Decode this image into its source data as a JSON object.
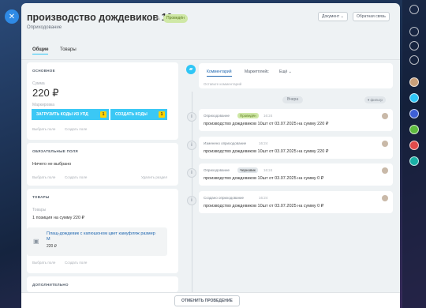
{
  "header": {
    "title": "производство дождевиков 10шт",
    "status_badge": "Проведён",
    "subtitle": "Оприходование",
    "document_button": "Документ",
    "feedback_button": "Обратная связь"
  },
  "tabs": [
    {
      "label": "Общие",
      "active": true
    },
    {
      "label": "Товары",
      "active": false
    }
  ],
  "main_section": {
    "title": "ОСНОВНОЕ",
    "sum_label": "Сумма",
    "sum_value": "220 ₽",
    "marking_label": "Маркировка",
    "upload_button": "ЗАГРУЗИТЬ КОДЫ ИЗ УПД",
    "upload_count": "1",
    "create_codes_button": "СОЗДАТЬ КОДЫ",
    "create_count": "1",
    "select_field": "Выбрать поле",
    "create_field": "Создать поле"
  },
  "required_section": {
    "title": "ОБЯЗАТЕЛЬНЫЕ ПОЛЯ",
    "value": "Ничего не выбрано",
    "select_field": "Выбрать поле",
    "create_field": "Создать поле",
    "hide_section": "Удалить раздел"
  },
  "products_section": {
    "title": "ТОВАРЫ",
    "label": "Товары",
    "summary": "1 позиция на сумму 220 ₽",
    "product_name": "Плащ-дождевик с капюшоном цвет камуфляж размер M",
    "product_price": "220 ₽",
    "select_field": "Выбрать поле",
    "create_field": "Создать поле"
  },
  "additional_section": {
    "title": "ДОПОЛНИТЕЛЬНО"
  },
  "feed": {
    "tabs": [
      "Комментарий",
      "Маркетплейс",
      "Ещё"
    ],
    "comment_placeholder": "Оставьте комментарий",
    "day_separator": "Вчера",
    "filter": "фильтр",
    "entries": [
      {
        "type": "Оприходование",
        "badge": "Проведён",
        "time": "16:24",
        "text": "производство дождевиков 10шт от 03.07.2025 на сумму 220 ₽"
      },
      {
        "type": "Изменено оприходование",
        "badge": "",
        "time": "16:24",
        "text": "производство дождевиков 10шт от 03.07.2025 на сумму 220 ₽"
      },
      {
        "type": "Оприходование",
        "badge": "Черновик",
        "time": "16:24",
        "text": "производство дождевиков 10шт от 03.07.2025 на сумму 0 ₽"
      },
      {
        "type": "Создано оприходование",
        "badge": "",
        "time": "16:24",
        "text": "производство дождевиков 10шт от 03.07.2025 на сумму 0 ₽"
      }
    ]
  },
  "footer": {
    "cancel_button": "ОТМЕНИТЬ ПРОВЕДЕНИЕ"
  }
}
